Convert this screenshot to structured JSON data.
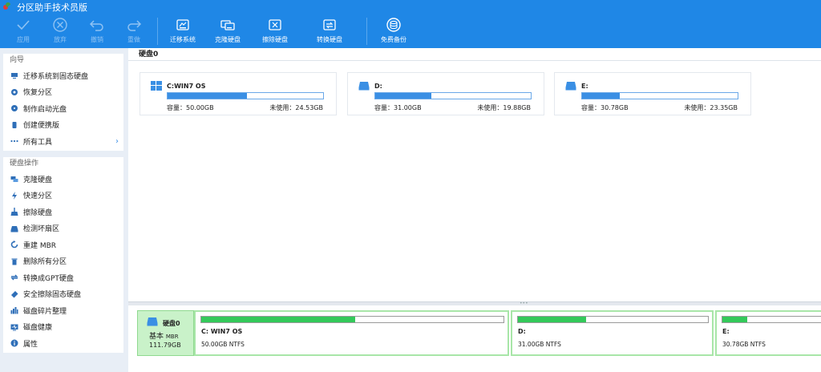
{
  "app": {
    "title": "分区助手技术员版"
  },
  "colors": {
    "accent": "#1f87e6",
    "bar_blue": "#3a8fe4",
    "bar_green": "#34c95a",
    "disk_label_bg": "#c9f2c9"
  },
  "toolbar": {
    "buttons": [
      {
        "label": "应用",
        "icon": "check-icon",
        "enabled": false
      },
      {
        "label": "放弃",
        "icon": "cancel-circle-icon",
        "enabled": false
      },
      {
        "label": "撤销",
        "icon": "undo-icon",
        "enabled": false
      },
      {
        "label": "重做",
        "icon": "redo-icon",
        "enabled": false
      },
      {
        "label": "迁移系统",
        "icon": "migrate-os-icon",
        "enabled": true
      },
      {
        "label": "克隆硬盘",
        "icon": "clone-disk-icon",
        "enabled": true
      },
      {
        "label": "擦除硬盘",
        "icon": "wipe-disk-icon",
        "enabled": true
      },
      {
        "label": "转换硬盘",
        "icon": "convert-disk-icon",
        "enabled": true
      },
      {
        "label": "免费备份",
        "icon": "backup-icon",
        "enabled": true
      }
    ]
  },
  "sidebar": {
    "wizard": {
      "title": "向导",
      "items": [
        {
          "label": "迁移系统到固态硬盘",
          "icon": "migrate-ssd-icon"
        },
        {
          "label": "恢复分区",
          "icon": "recover-partition-icon"
        },
        {
          "label": "制作启动光盘",
          "icon": "boot-disc-icon"
        },
        {
          "label": "创建便携版",
          "icon": "portable-icon"
        },
        {
          "label": "所有工具",
          "icon": "more-dots-icon",
          "has_arrow": true
        }
      ]
    },
    "disk_ops": {
      "title": "硬盘操作",
      "items": [
        {
          "label": "克隆硬盘",
          "icon": "clone-disk-icon"
        },
        {
          "label": "快速分区",
          "icon": "lightning-icon"
        },
        {
          "label": "擦除硬盘",
          "icon": "broom-icon"
        },
        {
          "label": "检测坏扇区",
          "icon": "disk-check-icon"
        },
        {
          "label": "重建 MBR",
          "icon": "rebuild-icon"
        },
        {
          "label": "删除所有分区",
          "icon": "trash-icon"
        },
        {
          "label": "转换成GPT硬盘",
          "icon": "convert-icon"
        },
        {
          "label": "安全擦除固态硬盘",
          "icon": "eraser-icon"
        },
        {
          "label": "磁盘碎片整理",
          "icon": "defrag-icon"
        },
        {
          "label": "磁盘健康",
          "icon": "health-icon"
        },
        {
          "label": "属性",
          "icon": "info-icon"
        }
      ]
    }
  },
  "main": {
    "disk_title": "硬盘0",
    "partitions": [
      {
        "name": "C:WIN7 OS",
        "icon": "windows-icon",
        "used_fraction": 0.51,
        "capacity": "容量：50.00GB",
        "free": "未使用：24.53GB"
      },
      {
        "name": "D:",
        "icon": "drive-icon",
        "used_fraction": 0.36,
        "capacity": "容量：31.00GB",
        "free": "未使用：19.88GB"
      },
      {
        "name": "E:",
        "icon": "drive-icon",
        "used_fraction": 0.24,
        "capacity": "容量：30.78GB",
        "free": "未使用：23.35GB"
      }
    ],
    "disk_map": {
      "name": "硬盘0",
      "type": "基本",
      "type_suffix": "MBR",
      "size": "111.79GB",
      "partitions": [
        {
          "name": "C: WIN7 OS",
          "info": "50.00GB NTFS",
          "used_fraction": 0.51
        },
        {
          "name": "D:",
          "info": "31.00GB NTFS",
          "used_fraction": 0.36
        },
        {
          "name": "E:",
          "info": "30.78GB NTFS",
          "used_fraction": 0.24
        }
      ]
    }
  }
}
